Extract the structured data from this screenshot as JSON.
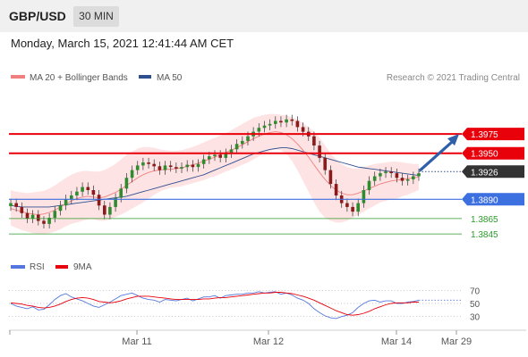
{
  "header": {
    "pair": "GBP/USD",
    "timeframe": "30 MIN"
  },
  "timestamp": "Monday, March 15, 2021 12:41:44 AM CET",
  "legend": {
    "ma20": "MA 20 + Bollinger Bands",
    "ma50": "MA 50",
    "copyright": "Research © 2021 Trading Central",
    "rsi": "RSI",
    "rsi_ma": "9MA"
  },
  "colors": {
    "resistance": "#e8000b",
    "support": "#3c6fe0",
    "target": "#2a9a2a",
    "current": "#333333",
    "ma20": "#f08080",
    "ma50": "#2f4f8f",
    "bollinger": "#fde0e0",
    "candle_up": "#2e8b2e",
    "candle_down": "#8b1a1a",
    "arrow": "#2f5fa8",
    "rsi": "#5577dd",
    "rsi_ma": "#e8000b"
  },
  "chart_data": {
    "type": "line",
    "title": "GBP/USD",
    "price_levels": [
      {
        "label": "1.3975",
        "value": 1.3975,
        "kind": "resistance"
      },
      {
        "label": "1.3950",
        "value": 1.395,
        "kind": "resistance"
      },
      {
        "label": "1.3926",
        "value": 1.3926,
        "kind": "current"
      },
      {
        "label": "1.3890",
        "value": 1.389,
        "kind": "support"
      },
      {
        "label": "1.3865",
        "value": 1.3865,
        "kind": "target"
      },
      {
        "label": "1.3845",
        "value": 1.3845,
        "kind": "target"
      }
    ],
    "x_ticks": [
      "Mar 11",
      "Mar 12",
      "Mar 14",
      "Mar 29"
    ],
    "ylim": [
      1.383,
      1.401
    ],
    "close": [
      1.3885,
      1.388,
      1.3872,
      1.3865,
      1.387,
      1.3862,
      1.3858,
      1.3866,
      1.3875,
      1.3882,
      1.389,
      1.3895,
      1.39,
      1.3906,
      1.3902,
      1.3896,
      1.3882,
      1.387,
      1.388,
      1.3892,
      1.3904,
      1.3918,
      1.3928,
      1.3934,
      1.3938,
      1.3936,
      1.3933,
      1.3928,
      1.3934,
      1.3932,
      1.393,
      1.3932,
      1.3935,
      1.3932,
      1.3936,
      1.3942,
      1.3946,
      1.3948,
      1.3944,
      1.395,
      1.3955,
      1.3962,
      1.3966,
      1.3972,
      1.3978,
      1.3983,
      1.3986,
      1.3988,
      1.3992,
      1.399,
      1.3994,
      1.3992,
      1.3984,
      1.3978,
      1.3972,
      1.396,
      1.3944,
      1.3928,
      1.391,
      1.3895,
      1.3885,
      1.388,
      1.3874,
      1.3885,
      1.3902,
      1.3914,
      1.392,
      1.3924,
      1.3926,
      1.3924,
      1.3918,
      1.3914,
      1.3916,
      1.392,
      1.3924
    ],
    "ma20": [
      1.3878,
      1.3876,
      1.3874,
      1.3872,
      1.3871,
      1.387,
      1.3871,
      1.3873,
      1.3876,
      1.388,
      1.3884,
      1.3888,
      1.3891,
      1.3893,
      1.3894,
      1.3893,
      1.3892,
      1.3893,
      1.3896,
      1.3899,
      1.3903,
      1.3908,
      1.3913,
      1.3918,
      1.3922,
      1.3925,
      1.3927,
      1.3928,
      1.3929,
      1.3929,
      1.393,
      1.3931,
      1.3933,
      1.3935,
      1.3937,
      1.394,
      1.3942,
      1.3945,
      1.3948,
      1.3951,
      1.3954,
      1.3957,
      1.3961,
      1.3965,
      1.3969,
      1.3972,
      1.3975,
      1.3977,
      1.3978,
      1.3977,
      1.3974,
      1.3969,
      1.3962,
      1.3954,
      1.3945,
      1.3935,
      1.3925,
      1.3916,
      1.3908,
      1.3902,
      1.3898,
      1.3896,
      1.3896,
      1.3898,
      1.3901,
      1.3904,
      1.3907,
      1.391,
      1.3912,
      1.3914,
      1.3915,
      1.3916,
      1.3917,
      1.3918,
      1.3919
    ],
    "ma50": [
      1.3882,
      1.3881,
      1.388,
      1.388,
      1.388,
      1.388,
      1.388,
      1.388,
      1.3881,
      1.3882,
      1.3883,
      1.3884,
      1.3885,
      1.3886,
      1.3887,
      1.3888,
      1.3889,
      1.389,
      1.3891,
      1.3892,
      1.3893,
      1.3894,
      1.3896,
      1.3898,
      1.39,
      1.3902,
      1.3904,
      1.3906,
      1.3908,
      1.391,
      1.3912,
      1.3914,
      1.3916,
      1.3918,
      1.392,
      1.3922,
      1.3925,
      1.3928,
      1.3931,
      1.3934,
      1.3937,
      1.394,
      1.3943,
      1.3946,
      1.3949,
      1.3951,
      1.3953,
      1.3955,
      1.3956,
      1.3957,
      1.3957,
      1.3956,
      1.3954,
      1.3952,
      1.395,
      1.3948,
      1.3946,
      1.3944,
      1.3942,
      1.394,
      1.3938,
      1.3936,
      1.3934,
      1.3932,
      1.3931,
      1.393,
      1.3929,
      1.3928,
      1.3927,
      1.3926,
      1.3925,
      1.3924,
      1.3923,
      1.3922,
      1.3921
    ],
    "bb_upper": [
      1.3902,
      1.39,
      1.3899,
      1.3898,
      1.3899,
      1.39,
      1.3901,
      1.3904,
      1.3908,
      1.3913,
      1.3918,
      1.3922,
      1.3925,
      1.3927,
      1.3927,
      1.3926,
      1.3926,
      1.3928,
      1.3932,
      1.3936,
      1.3942,
      1.3948,
      1.3952,
      1.3956,
      1.3958,
      1.3958,
      1.3957,
      1.3955,
      1.3954,
      1.3953,
      1.3953,
      1.3954,
      1.3956,
      1.3958,
      1.3961,
      1.3964,
      1.3967,
      1.397,
      1.3973,
      1.3976,
      1.398,
      1.3984,
      1.3988,
      1.3992,
      1.3996,
      1.3998,
      1.4,
      1.4001,
      1.4001,
      1.4,
      1.3999,
      1.3997,
      1.3994,
      1.3989,
      1.3984,
      1.3978,
      1.397,
      1.396,
      1.395,
      1.3942,
      1.3936,
      1.3932,
      1.393,
      1.393,
      1.3932,
      1.3934,
      1.3936,
      1.3937,
      1.3938,
      1.3939,
      1.3939,
      1.3938,
      1.3937,
      1.3936,
      1.3936
    ],
    "bb_lower": [
      1.3856,
      1.3853,
      1.385,
      1.3848,
      1.3846,
      1.3845,
      1.3845,
      1.3846,
      1.3848,
      1.3851,
      1.3855,
      1.3858,
      1.386,
      1.3862,
      1.3864,
      1.3864,
      1.3862,
      1.3862,
      1.3864,
      1.3867,
      1.387,
      1.3874,
      1.3878,
      1.3882,
      1.3886,
      1.3891,
      1.3896,
      1.39,
      1.3903,
      1.3905,
      1.3906,
      1.3907,
      1.3909,
      1.3911,
      1.3913,
      1.3915,
      1.3918,
      1.392,
      1.3923,
      1.3926,
      1.3929,
      1.3932,
      1.3935,
      1.3938,
      1.3942,
      1.3946,
      1.395,
      1.3953,
      1.3955,
      1.3954,
      1.3949,
      1.394,
      1.3928,
      1.3914,
      1.39,
      1.3886,
      1.3874,
      1.3866,
      1.3862,
      1.386,
      1.386,
      1.3862,
      1.3866,
      1.387,
      1.3874,
      1.3878,
      1.3882,
      1.3886,
      1.3888,
      1.389,
      1.3891,
      1.3894,
      1.3896,
      1.3899,
      1.3902
    ],
    "forecast_arrow": {
      "from": 1.3926,
      "to": 1.3975
    },
    "rsi_ticks": [
      70,
      50,
      30
    ],
    "rsi_ylim": [
      20,
      80
    ],
    "rsi": [
      50,
      46,
      44,
      42,
      45,
      40,
      41,
      48,
      56,
      62,
      65,
      60,
      57,
      54,
      50,
      46,
      44,
      48,
      52,
      57,
      62,
      64,
      66,
      62,
      58,
      56,
      55,
      52,
      56,
      55,
      54,
      56,
      58,
      54,
      57,
      60,
      60,
      62,
      58,
      62,
      63,
      64,
      64,
      66,
      66,
      68,
      66,
      67,
      68,
      64,
      66,
      63,
      58,
      55,
      50,
      42,
      36,
      31,
      28,
      27,
      30,
      32,
      36,
      44,
      50,
      54,
      55,
      52,
      54,
      54,
      50,
      50,
      52,
      53,
      55
    ],
    "rsi_ma": [
      51,
      50,
      49,
      47,
      46,
      44,
      43,
      44,
      46,
      49,
      53,
      56,
      58,
      59,
      58,
      56,
      53,
      52,
      51,
      52,
      54,
      57,
      59,
      61,
      61,
      61,
      60,
      59,
      58,
      57,
      56,
      56,
      56,
      56,
      56,
      57,
      57,
      58,
      59,
      59,
      60,
      61,
      62,
      63,
      64,
      65,
      66,
      66,
      67,
      67,
      66,
      65,
      63,
      61,
      58,
      55,
      51,
      47,
      43,
      39,
      36,
      33,
      32,
      33,
      35,
      38,
      42,
      45,
      48,
      50,
      51,
      51,
      51,
      52,
      52
    ]
  }
}
